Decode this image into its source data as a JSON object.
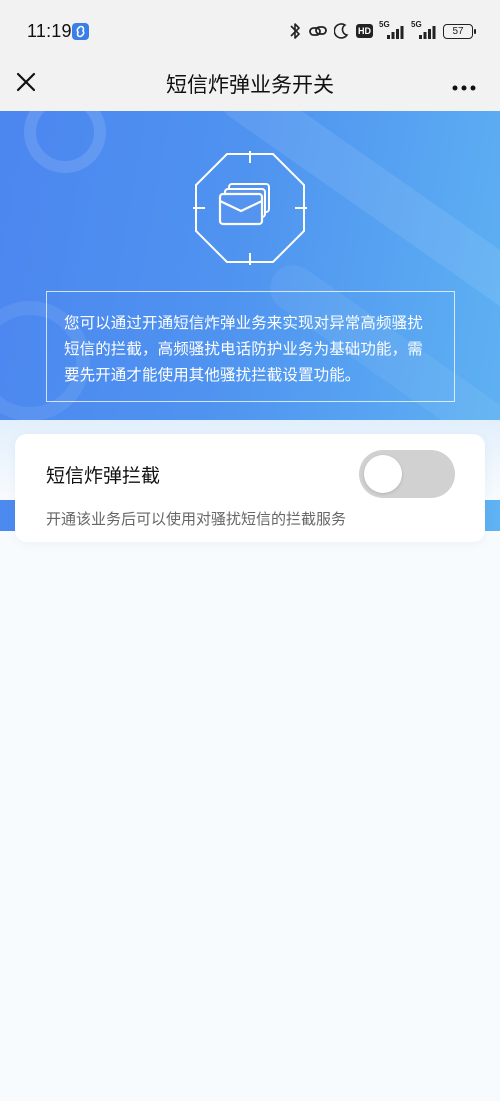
{
  "status_bar": {
    "time": "11:19",
    "network1": "5G",
    "network2": "5G",
    "hd_label": "HD",
    "battery": "57",
    "icons": [
      "app-link-icon",
      "bluetooth-icon",
      "link-icon",
      "moon-icon",
      "signal-icon",
      "battery-icon"
    ]
  },
  "nav": {
    "title": "短信炸弹业务开关",
    "left_icon": "close-icon",
    "right_icon": "more-icon"
  },
  "hero": {
    "icon": "envelope-stack-icon",
    "description": "您可以通过开通短信炸弹业务来实现对异常高频骚扰短信的拦截，高频骚扰电话防护业务为基础功能，需要先开通才能使用其他骚扰拦截设置功能。"
  },
  "card": {
    "title": "短信炸弹拦截",
    "subtitle": "开通该业务后可以使用对骚扰短信的拦截服务",
    "toggle_on": false
  },
  "colors": {
    "hero_start": "#4c86ef",
    "hero_end": "#5fb3f3",
    "toggle_off": "#d1d1d1",
    "page_bg": "#f8fbfe"
  }
}
